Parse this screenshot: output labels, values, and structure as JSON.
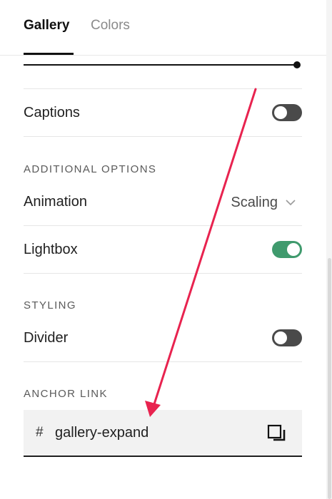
{
  "tabs": [
    {
      "label": "Gallery",
      "active": true
    },
    {
      "label": "Colors",
      "active": false
    }
  ],
  "slider": {
    "value_fraction": 1.0
  },
  "rows": {
    "captions": {
      "label": "Captions",
      "enabled": false
    },
    "animation": {
      "label": "Animation",
      "value": "Scaling"
    },
    "lightbox": {
      "label": "Lightbox",
      "enabled": true
    },
    "divider": {
      "label": "Divider",
      "enabled": false
    }
  },
  "sections": {
    "additional_options": "ADDITIONAL OPTIONS",
    "styling": "STYLING",
    "anchor_link": "ANCHOR LINK"
  },
  "anchor": {
    "prefix": "#",
    "value": "gallery-expand"
  },
  "icons": {
    "copy": "copy-icon",
    "chevron": "chevron-down-icon"
  },
  "colors": {
    "toggle_on": "#3f9a6d",
    "toggle_off": "#4a4a4a",
    "annotation_arrow": "#e8234f"
  }
}
